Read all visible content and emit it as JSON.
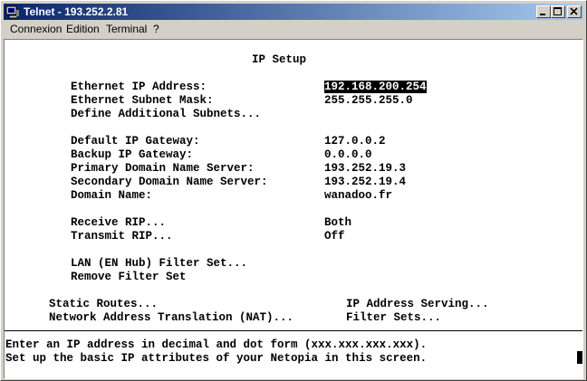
{
  "window": {
    "title": "Telnet - 193.252.2.81",
    "icons": {
      "app": "telnet-icon",
      "minimize": "minimize-icon",
      "maximize": "maximize-icon",
      "close": "close-icon"
    }
  },
  "menu": [
    "Connexion",
    "Edition",
    "Terminal",
    "?"
  ],
  "screen": {
    "title": "IP Setup",
    "fields": [
      {
        "label": "Ethernet IP Address:",
        "value": "192.168.200.254",
        "selected": true
      },
      {
        "label": "Ethernet Subnet Mask:",
        "value": "255.255.255.0"
      },
      {
        "label": "Define Additional Subnets...",
        "value": ""
      },
      {
        "label": "Default IP Gateway:",
        "value": "127.0.0.2"
      },
      {
        "label": "Backup IP Gateway:",
        "value": "0.0.0.0"
      },
      {
        "label": "Primary Domain Name Server:",
        "value": "193.252.19.3"
      },
      {
        "label": "Secondary Domain Name Server:",
        "value": "193.252.19.4"
      },
      {
        "label": "Domain Name:",
        "value": "wanadoo.fr"
      },
      {
        "label": "Receive RIP...",
        "value": "Both"
      },
      {
        "label": "Transmit RIP...",
        "value": "Off"
      },
      {
        "label": "LAN (EN Hub) Filter Set...",
        "value": ""
      },
      {
        "label": "Remove Filter Set",
        "value": ""
      }
    ],
    "links_left": [
      "Static Routes...",
      "Network Address Translation (NAT)..."
    ],
    "links_right": [
      "IP Address Serving...",
      "Filter Sets..."
    ],
    "help_lines": [
      "Enter an IP address in decimal and dot form (xxx.xxx.xxx.xxx).",
      "Set up the basic IP attributes of your Netopia in this screen."
    ]
  }
}
